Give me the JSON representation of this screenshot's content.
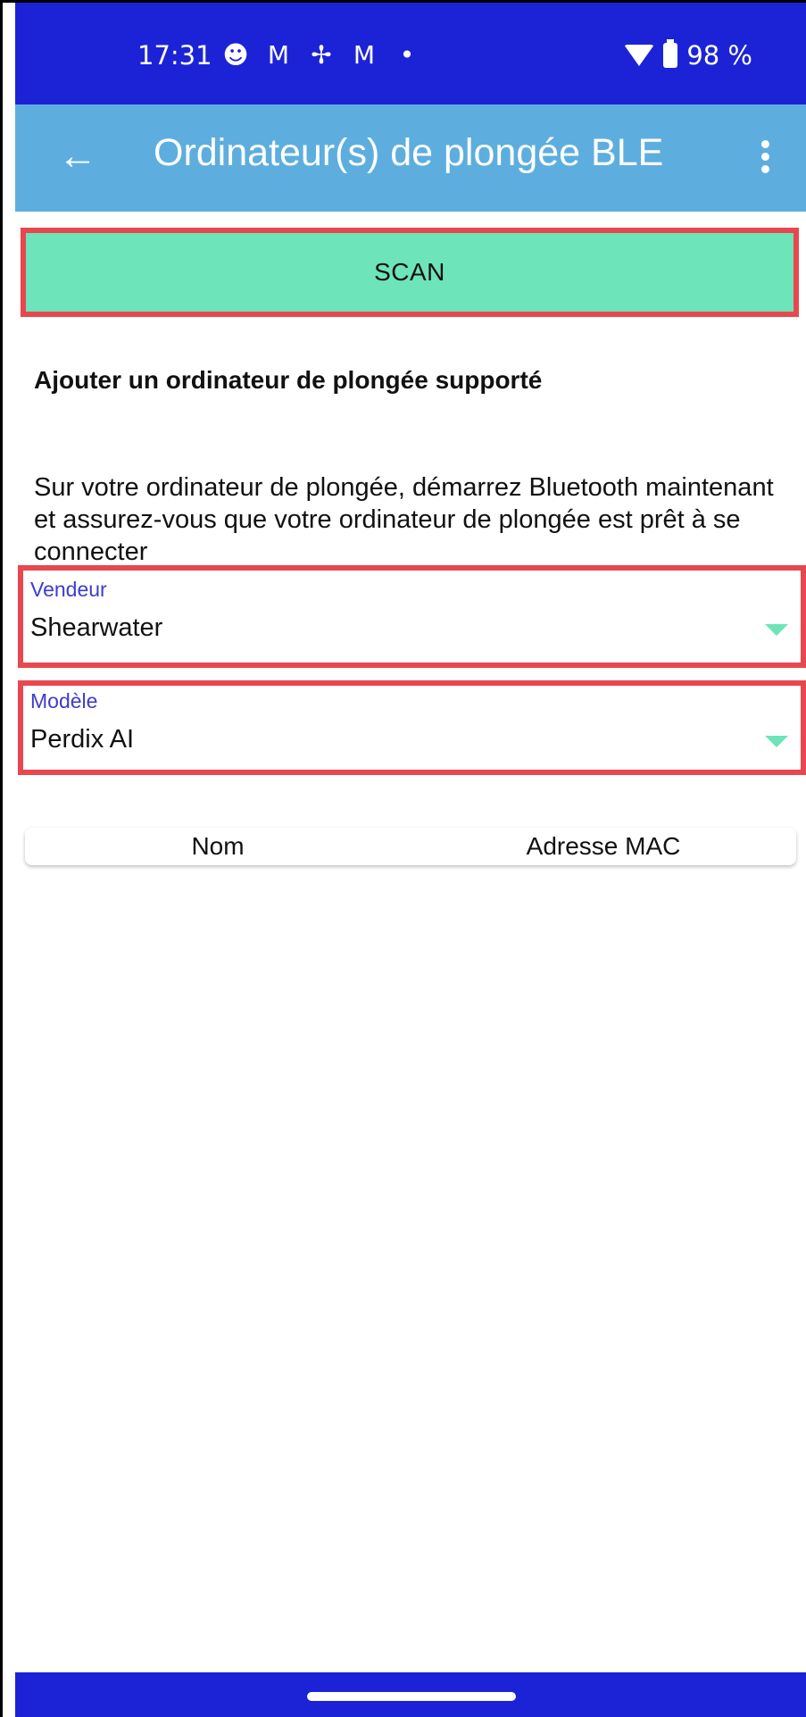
{
  "status_bar": {
    "time": "17:31",
    "battery": "98 %",
    "icons": [
      "face-icon",
      "gmail-icon",
      "fan-icon",
      "gmail-icon",
      "dot-icon"
    ]
  },
  "app_bar": {
    "title": "Ordinateur(s) de plongée BLE",
    "back_label": "←"
  },
  "scan_button": {
    "label": "SCAN"
  },
  "section": {
    "title": "Ajouter un ordinateur de plongée supporté",
    "instructions": "Sur votre ordinateur de plongée, démarrez Bluetooth maintenant et assurez-vous que votre ordinateur de plongée est prêt à se connecter"
  },
  "vendor_field": {
    "label": "Vendeur",
    "value": "Shearwater"
  },
  "model_field": {
    "label": "Modèle",
    "value": "Perdix AI"
  },
  "device_table": {
    "columns": [
      "Nom",
      "Adresse MAC"
    ]
  },
  "colors": {
    "status_bar": "#1c23d6",
    "app_bar": "#5daede",
    "scan_button": "#6de4b9",
    "highlight_border": "#e8474f"
  }
}
